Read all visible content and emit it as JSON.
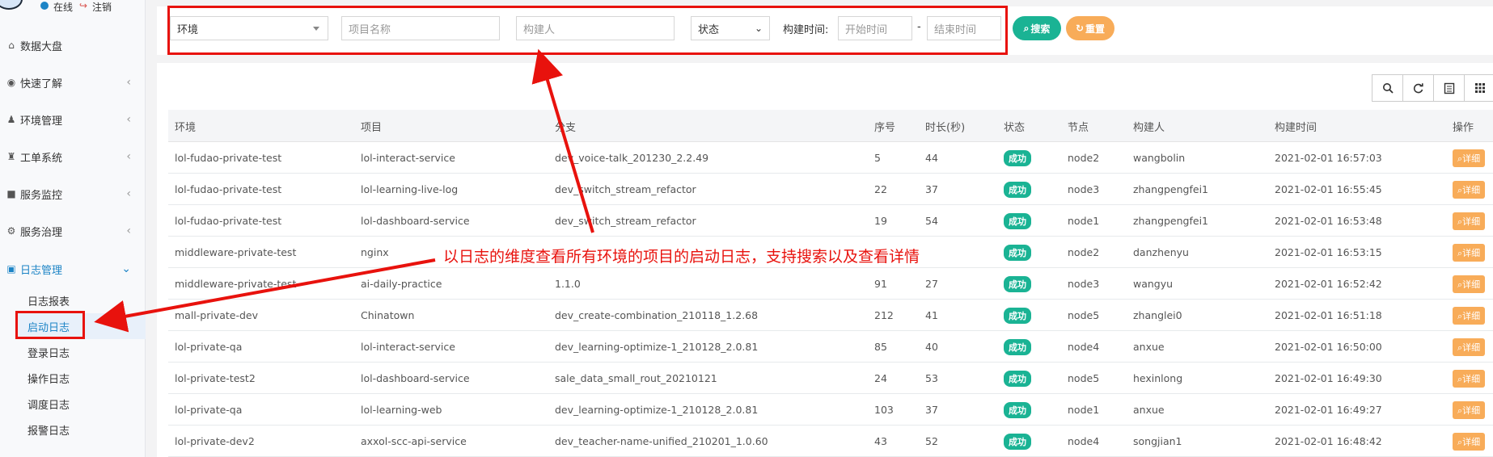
{
  "user": {
    "status": "在线",
    "logout": "注销"
  },
  "sidebar": {
    "items": [
      {
        "icon": "home-icon",
        "glyph": "⌂",
        "label": "数据大盘",
        "has_children": false
      },
      {
        "icon": "eye-icon",
        "glyph": "◉",
        "label": "快速了解",
        "has_children": true
      },
      {
        "icon": "users-icon",
        "glyph": "♟",
        "label": "环境管理",
        "has_children": true
      },
      {
        "icon": "ticket-icon",
        "glyph": "♜",
        "label": "工单系统",
        "has_children": true
      },
      {
        "icon": "video-icon",
        "glyph": "■",
        "label": "服务监控",
        "has_children": true
      },
      {
        "icon": "gears-icon",
        "glyph": "⚙",
        "label": "服务治理",
        "has_children": true
      },
      {
        "icon": "log-icon",
        "glyph": "▣",
        "label": "日志管理",
        "has_children": true,
        "expanded": true
      }
    ],
    "sub_items": [
      "日志报表",
      "启动日志",
      "登录日志",
      "操作日志",
      "调度日志",
      "报警日志"
    ],
    "active_sub": "启动日志"
  },
  "search": {
    "env_select": "环境",
    "project_placeholder": "项目名称",
    "builder_placeholder": "构建人",
    "status_select": "状态",
    "time_label": "构建时间:",
    "start_placeholder": "开始时间",
    "end_placeholder": "结束时间",
    "dash": "-",
    "search_button": "搜索",
    "reset_button": "重置"
  },
  "table": {
    "headers": [
      "环境",
      "项目",
      "分支",
      "序号",
      "时长(秒)",
      "状态",
      "节点",
      "构建人",
      "构建时间",
      "操作"
    ],
    "rows": [
      [
        "lol-fudao-private-test",
        "lol-interact-service",
        "dev_voice-talk_201230_2.2.49",
        "5",
        "44",
        "成功",
        "node2",
        "wangbolin",
        "2021-02-01 16:57:03",
        "详细"
      ],
      [
        "lol-fudao-private-test",
        "lol-learning-live-log",
        "dev_switch_stream_refactor",
        "22",
        "37",
        "成功",
        "node3",
        "zhangpengfei1",
        "2021-02-01 16:55:45",
        "详细"
      ],
      [
        "lol-fudao-private-test",
        "lol-dashboard-service",
        "dev_switch_stream_refactor",
        "19",
        "54",
        "成功",
        "node1",
        "zhangpengfei1",
        "2021-02-01 16:53:48",
        "详细"
      ],
      [
        "middleware-private-test",
        "nginx",
        "",
        "",
        "",
        "成功",
        "node2",
        "danzhenyu",
        "2021-02-01 16:53:15",
        "详细"
      ],
      [
        "middleware-private-test",
        "ai-daily-practice",
        "1.1.0",
        "91",
        "27",
        "成功",
        "node3",
        "wangyu",
        "2021-02-01 16:52:42",
        "详细"
      ],
      [
        "mall-private-dev",
        "Chinatown",
        "dev_create-combination_210118_1.2.68",
        "212",
        "41",
        "成功",
        "node5",
        "zhanglei0",
        "2021-02-01 16:51:18",
        "详细"
      ],
      [
        "lol-private-qa",
        "lol-interact-service",
        "dev_learning-optimize-1_210128_2.0.81",
        "85",
        "40",
        "成功",
        "node4",
        "anxue",
        "2021-02-01 16:50:00",
        "详细"
      ],
      [
        "lol-private-test2",
        "lol-dashboard-service",
        "sale_data_small_rout_20210121",
        "24",
        "53",
        "成功",
        "node5",
        "hexinlong",
        "2021-02-01 16:49:30",
        "详细"
      ],
      [
        "lol-private-qa",
        "lol-learning-web",
        "dev_learning-optimize-1_210128_2.0.81",
        "103",
        "37",
        "成功",
        "node1",
        "anxue",
        "2021-02-01 16:49:27",
        "详细"
      ],
      [
        "lol-private-dev2",
        "axxol-scc-api-service",
        "dev_teacher-name-unified_210201_1.0.60",
        "43",
        "52",
        "成功",
        "node4",
        "songjian1",
        "2021-02-01 16:48:42",
        "详细"
      ]
    ]
  },
  "annotation": {
    "text": "以日志的维度查看所有环境的项目的启动日志，支持搜索以及查看详情",
    "color": "#e8120d"
  },
  "colors": {
    "primary": "#1ab394",
    "warning": "#f8ac59",
    "accent": "#1c84c6"
  }
}
